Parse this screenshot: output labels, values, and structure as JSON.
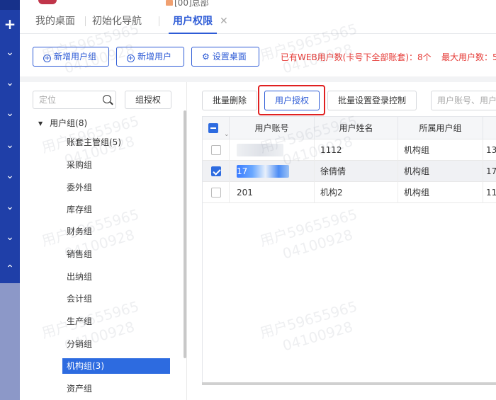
{
  "top": {
    "title": "[00]总部"
  },
  "tabs": [
    {
      "label": "我的桌面"
    },
    {
      "label": "初始化导航"
    },
    {
      "label": "用户权限"
    }
  ],
  "actions": {
    "add_group": "新增用户组",
    "add_user": "新增用户",
    "set_desktop": "设置桌面",
    "web_user_count": "已有WEB用户数(卡号下全部账套)：8个",
    "max_user_count": "最大用户数：5"
  },
  "tree": {
    "search_placeholder": "定位",
    "group_auth": "组授权",
    "root": "用户组(8)",
    "nodes": [
      "账套主管组(5)",
      "采购组",
      "委外组",
      "库存组",
      "财务组",
      "销售组",
      "出纳组",
      "会计组",
      "生产组",
      "分销组",
      "机构组(3)",
      "资产组"
    ],
    "selected": "机构组(3)"
  },
  "right": {
    "batch_delete": "批量删除",
    "user_auth": "用户授权",
    "batch_login": "批量设置登录控制",
    "search_placeholder": "用户账号、用户"
  },
  "table": {
    "headers": [
      "用户账号",
      "用户姓名",
      "所属用户组"
    ],
    "rows": [
      {
        "account": "",
        "name": "1112",
        "group": "机构组",
        "extra": "13",
        "checked": false
      },
      {
        "account": "17",
        "name": "徐倩倩",
        "group": "机构组",
        "extra": "17",
        "checked": true
      },
      {
        "account": "201",
        "name": "机构2",
        "group": "机构组",
        "extra": "11",
        "checked": false
      }
    ]
  },
  "watermark": {
    "line1": "用户59655965",
    "line2": "04100928"
  }
}
